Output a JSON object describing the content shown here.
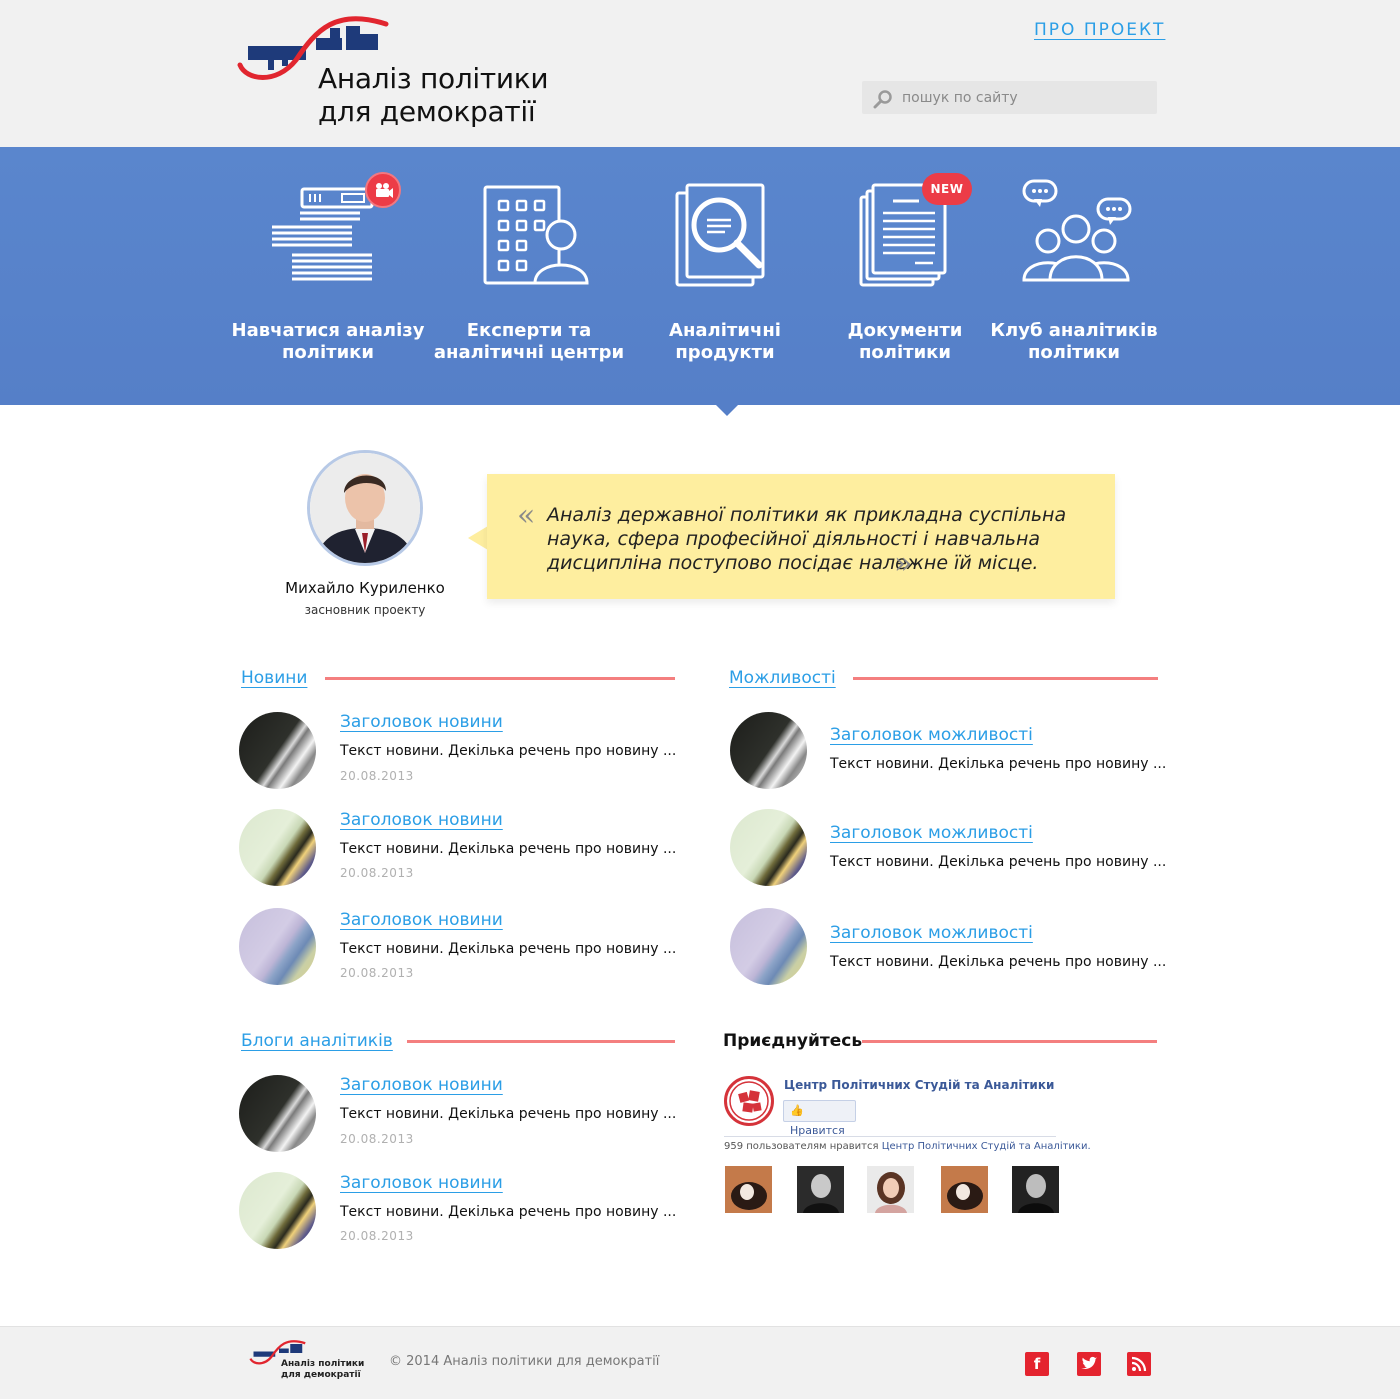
{
  "header": {
    "logo_title_line1": "Аналіз політики",
    "logo_title_line2": "для демократії",
    "about_link": "ПРО ПРОЕКТ",
    "search_placeholder": "пошук по сайту"
  },
  "colors": {
    "accent": "#2b9ee6",
    "banner": "#5a86cd",
    "badge": "#ec3c47",
    "section_line": "#f47f7f",
    "quote_bg": "#feee9f",
    "logo_blue": "#1e3a7a",
    "logo_red": "#e1262f"
  },
  "nav": {
    "items": [
      {
        "label": "Навчатися аналізу політики",
        "icon": "documents-video-icon"
      },
      {
        "label": "Експерти та аналітичні центри",
        "icon": "building-person-icon"
      },
      {
        "label": "Аналітичні продукти",
        "icon": "magnifier-document-icon"
      },
      {
        "label": "Документи політики",
        "icon": "documents-stack-icon"
      },
      {
        "label": "Клуб аналітиків політики",
        "icon": "people-chat-icon"
      }
    ],
    "badge_new": "NEW"
  },
  "quote": {
    "open_mark": "«",
    "close_mark": "»",
    "text": "Аналіз державної політики як прикладна суспільна наука, сфера професійної діяльності і навчальна дисципліна поступово посідає належне їй місце.",
    "author_name": "Михайло Куриленко",
    "author_role": "засновник проекту"
  },
  "news": {
    "title": "Новини",
    "items": [
      {
        "title": "Заголовок новини",
        "text": "Текст новини. Декілька речень про новину ...",
        "date": "20.08.2013"
      },
      {
        "title": "Заголовок новини",
        "text": "Текст новини. Декілька речень про новину ...",
        "date": "20.08.2013"
      },
      {
        "title": "Заголовок новини",
        "text": "Текст новини. Декілька речень про новину ...",
        "date": "20.08.2013"
      }
    ]
  },
  "opportunities": {
    "title": "Можливості",
    "items": [
      {
        "title": "Заголовок можливості",
        "text": "Текст новини. Декілька речень про новину ..."
      },
      {
        "title": "Заголовок можливості",
        "text": "Текст новини. Декілька речень про новину ..."
      },
      {
        "title": "Заголовок можливості",
        "text": "Текст новини. Декілька речень про новину ..."
      }
    ]
  },
  "blogs": {
    "title": "Блоги аналітиків",
    "items": [
      {
        "title": "Заголовок новини",
        "text": "Текст новини. Декілька речень про новину ...",
        "date": "20.08.2013"
      },
      {
        "title": "Заголовок новини",
        "text": "Текст новини. Декілька речень про новину ...",
        "date": "20.08.2013"
      }
    ]
  },
  "join": {
    "title": "Приєднуйтесь",
    "page_name": "Центр Політичних Студій та Аналітики",
    "like_button": "Нравится",
    "count_text": "959 пользователям нравится",
    "count_link": "Центр Політичних Студій та Аналітики."
  },
  "footer": {
    "logo_line1": "Аналіз політики",
    "logo_line2": "для демократії",
    "copyright": "© 2014 Аналіз політики для демократії",
    "social": [
      {
        "icon": "facebook-icon",
        "glyph": "f"
      },
      {
        "icon": "twitter-icon",
        "glyph": "t"
      },
      {
        "icon": "rss-icon",
        "glyph": "rss"
      }
    ]
  }
}
